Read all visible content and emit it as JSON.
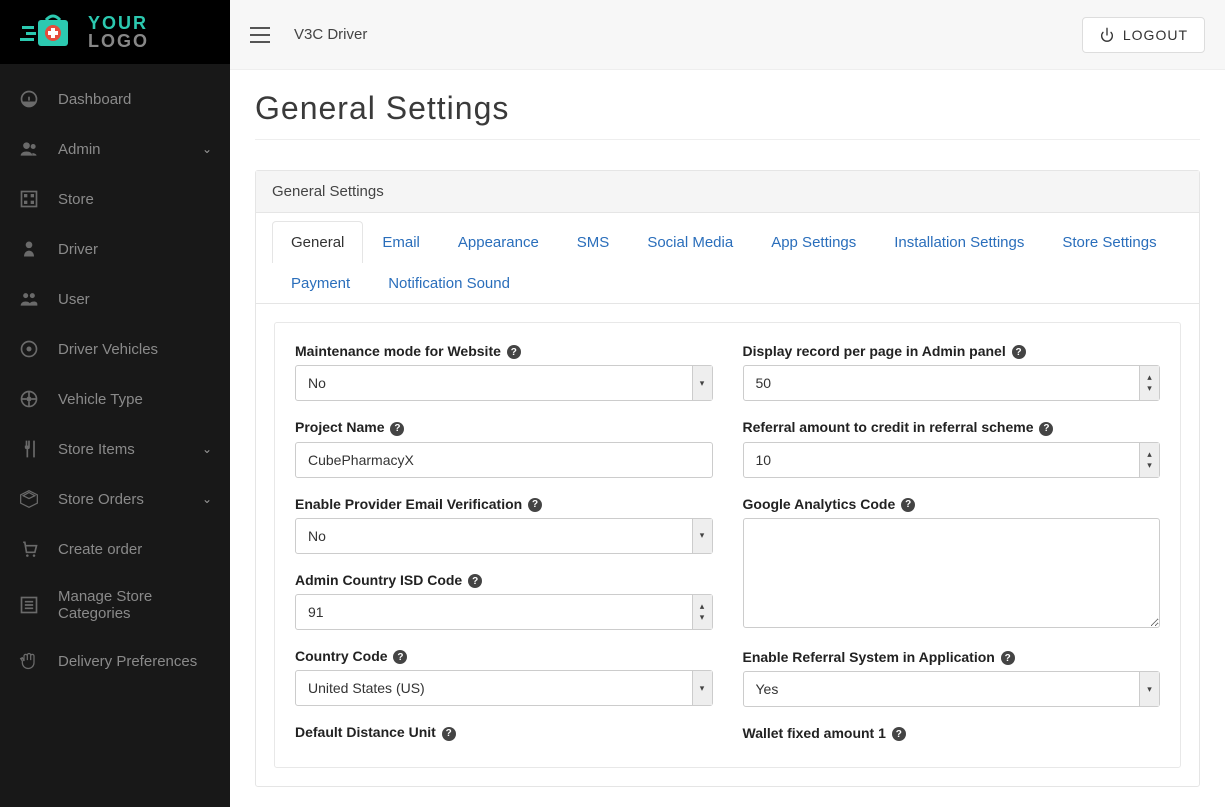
{
  "logo": {
    "top": "YOUR",
    "bot": "LOGO"
  },
  "sidebar": {
    "items": [
      {
        "label": "Dashboard",
        "icon": "dashboard",
        "expandable": false
      },
      {
        "label": "Admin",
        "icon": "admin",
        "expandable": true
      },
      {
        "label": "Store",
        "icon": "store",
        "expandable": false
      },
      {
        "label": "Driver",
        "icon": "driver",
        "expandable": false
      },
      {
        "label": "User",
        "icon": "users",
        "expandable": false
      },
      {
        "label": "Driver Vehicles",
        "icon": "target",
        "expandable": false
      },
      {
        "label": "Vehicle Type",
        "icon": "wheel",
        "expandable": false
      },
      {
        "label": "Store Items",
        "icon": "cutlery",
        "expandable": true
      },
      {
        "label": "Store Orders",
        "icon": "box",
        "expandable": true
      },
      {
        "label": "Create order",
        "icon": "cart",
        "expandable": false
      },
      {
        "label": "Manage Store Categories",
        "icon": "list",
        "expandable": false
      },
      {
        "label": "Delivery Preferences",
        "icon": "hand",
        "expandable": false
      }
    ]
  },
  "topbar": {
    "breadcrumb": "V3C  Driver",
    "logout": "LOGOUT"
  },
  "page": {
    "title": "General Settings",
    "panel_title": "General Settings"
  },
  "tabs": [
    "General",
    "Email",
    "Appearance",
    "SMS",
    "Social Media",
    "App Settings",
    "Installation Settings",
    "Store Settings",
    "Payment",
    "Notification Sound"
  ],
  "active_tab": "General",
  "form": {
    "left": [
      {
        "label": "Maintenance mode for Website",
        "type": "select",
        "value": "No"
      },
      {
        "label": "Project Name",
        "type": "text",
        "value": "CubePharmacyX"
      },
      {
        "label": "Enable Provider Email Verification",
        "type": "select",
        "value": "No"
      },
      {
        "label": "Admin Country ISD Code",
        "type": "number",
        "value": "91"
      },
      {
        "label": "Country Code",
        "type": "select",
        "value": "United States (US)"
      },
      {
        "label": "Default Distance Unit",
        "type": "select",
        "value": ""
      }
    ],
    "right": [
      {
        "label": "Display record per page in Admin panel",
        "type": "number",
        "value": "50"
      },
      {
        "label": "Referral amount to credit in referral scheme",
        "type": "number",
        "value": "10"
      },
      {
        "label": "Google Analytics Code",
        "type": "textarea",
        "value": ""
      },
      {
        "label": "Enable Referral System in Application",
        "type": "select",
        "value": "Yes"
      },
      {
        "label": "Wallet fixed amount 1",
        "type": "number",
        "value": ""
      }
    ]
  }
}
